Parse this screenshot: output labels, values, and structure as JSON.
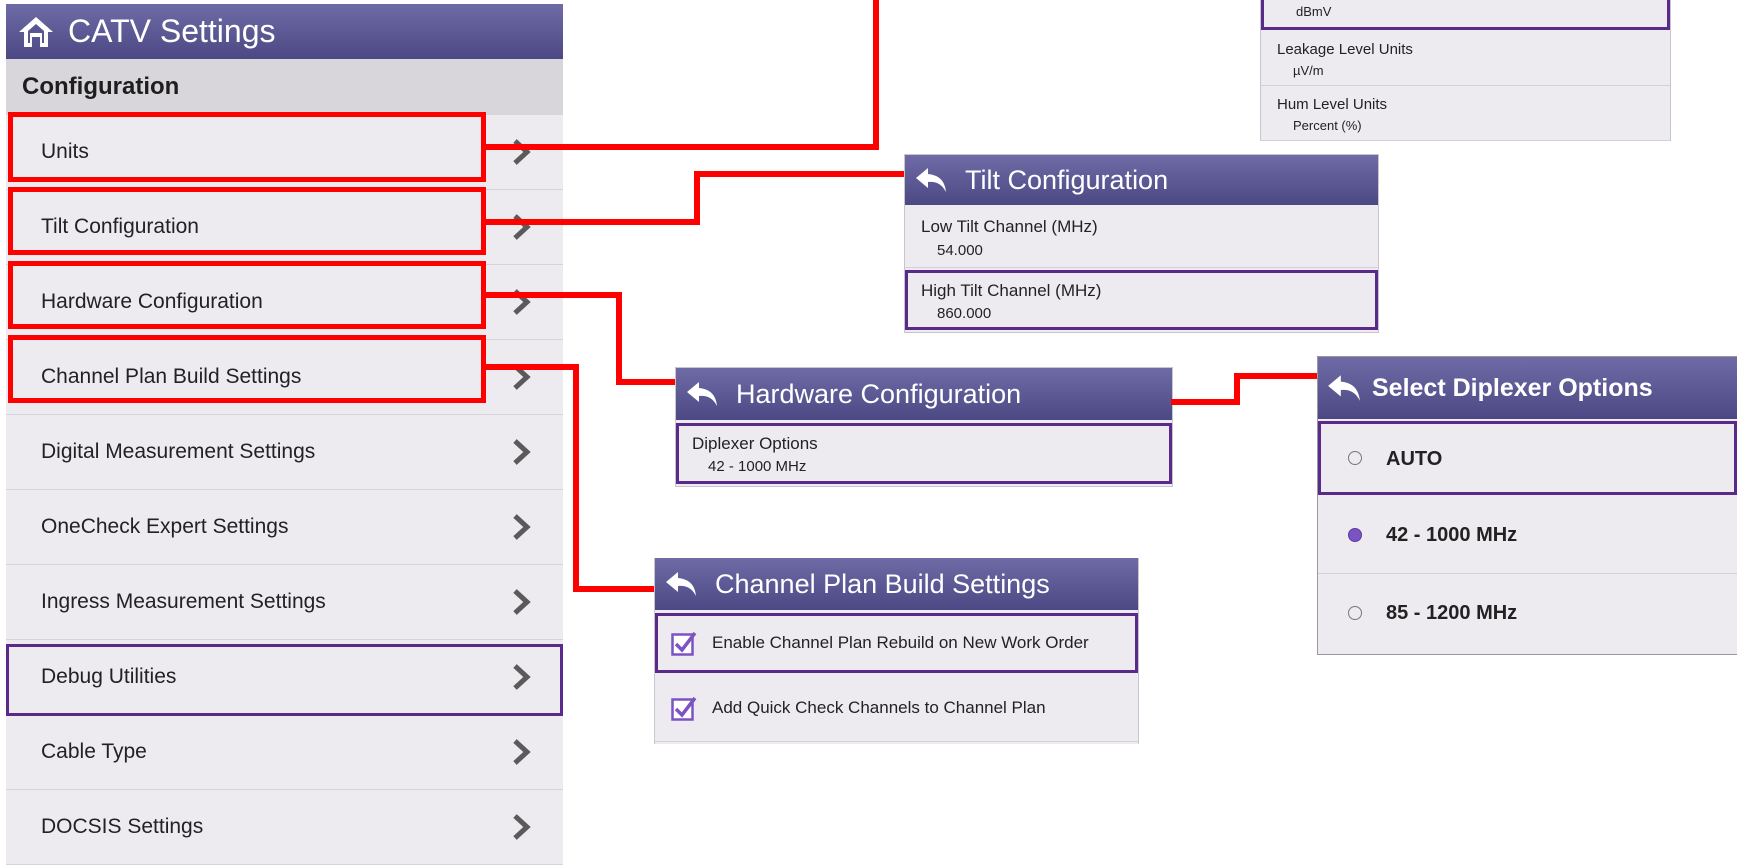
{
  "main": {
    "title": "CATV Settings",
    "section": "Configuration",
    "items": [
      {
        "label": "Units"
      },
      {
        "label": "Tilt Configuration"
      },
      {
        "label": "Hardware Configuration"
      },
      {
        "label": "Channel Plan Build Settings"
      },
      {
        "label": "Digital Measurement Settings"
      },
      {
        "label": "OneCheck Expert Settings"
      },
      {
        "label": "Ingress Measurement Settings"
      },
      {
        "label": "Debug Utilities"
      },
      {
        "label": "Cable Type"
      },
      {
        "label": "DOCSIS Settings"
      }
    ]
  },
  "units_popup": {
    "partial_value": "dBmV",
    "rows": [
      {
        "label": "Leakage Level Units",
        "value": "µV/m"
      },
      {
        "label": "Hum Level Units",
        "value": "Percent (%)"
      }
    ]
  },
  "tilt_popup": {
    "title": "Tilt Configuration",
    "rows": [
      {
        "label": "Low Tilt Channel (MHz)",
        "value": "54.000"
      },
      {
        "label": "High Tilt Channel (MHz)",
        "value": "860.000"
      }
    ]
  },
  "hardware_popup": {
    "title": "Hardware Configuration",
    "rows": [
      {
        "label": "Diplexer Options",
        "value": "42 - 1000 MHz"
      }
    ]
  },
  "diplexer_popup": {
    "title": "Select Diplexer Options",
    "options": [
      {
        "label": "AUTO",
        "selected": false
      },
      {
        "label": "42 - 1000 MHz",
        "selected": true
      },
      {
        "label": "85 - 1200 MHz",
        "selected": false
      }
    ]
  },
  "channel_plan_popup": {
    "title": "Channel Plan Build Settings",
    "rows": [
      {
        "label": "Enable Channel Plan Rebuild on New Work Order",
        "checked": true
      },
      {
        "label": "Add Quick Check Channels to Channel Plan",
        "checked": true
      }
    ]
  },
  "colors": {
    "titlebar": "#5a5693",
    "panel_bg": "#eeebf0",
    "highlight_red": "#ff0000",
    "selection_purple": "#5a2a8a",
    "radio_selected": "#7c53c3"
  },
  "icons": {
    "home": "home-icon",
    "back": "back-arrow-icon",
    "chevron": "chevron-right-icon",
    "checkbox": "checkbox-checked-icon"
  }
}
